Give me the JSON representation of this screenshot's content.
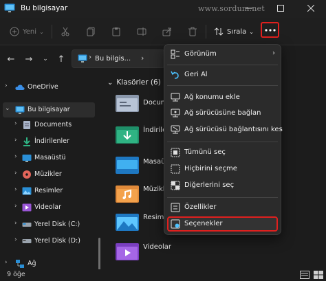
{
  "window": {
    "title": "Bu bilgisayar",
    "watermark": "www.sordum.net"
  },
  "toolbar": {
    "new_label": "Yeni",
    "sort_label": "Sırala"
  },
  "address": {
    "crumb": "Bu bilgis..."
  },
  "sidebar": {
    "items": [
      {
        "label": "OneDrive",
        "icon": "cloud-icon"
      },
      {
        "label": "Bu bilgisayar",
        "icon": "computer-icon"
      },
      {
        "label": "Documents",
        "icon": "documents-icon"
      },
      {
        "label": "İndirilenler",
        "icon": "downloads-icon"
      },
      {
        "label": "Masaüstü",
        "icon": "desktop-icon"
      },
      {
        "label": "Müzikler",
        "icon": "music-icon"
      },
      {
        "label": "Resimler",
        "icon": "pictures-icon"
      },
      {
        "label": "Videolar",
        "icon": "videos-icon"
      },
      {
        "label": "Yerel Disk (C:)",
        "icon": "drive-icon"
      },
      {
        "label": "Yerel Disk (D:)",
        "icon": "drive-icon"
      },
      {
        "label": "Ağ",
        "icon": "network-icon"
      }
    ]
  },
  "main": {
    "group_header": "Klasörler (6)",
    "folders": [
      {
        "label": "Docum",
        "icon": "documents-folder-icon"
      },
      {
        "label": "İndirile",
        "icon": "downloads-folder-icon"
      },
      {
        "label": "Masaüs",
        "icon": "desktop-folder-icon"
      },
      {
        "label": "Müzikle",
        "icon": "music-folder-icon"
      },
      {
        "label": "Resimle",
        "icon": "pictures-folder-icon"
      },
      {
        "label": "Videolar",
        "icon": "videos-folder-icon"
      }
    ]
  },
  "menu": {
    "items": [
      {
        "label": "Görünüm",
        "icon": "view-icon",
        "submenu": true
      },
      {
        "label": "Geri Al",
        "icon": "undo-icon"
      },
      {
        "label": "Ağ konumu ekle",
        "icon": "add-network-location-icon"
      },
      {
        "label": "Ağ sürücüsüne bağlan",
        "icon": "map-network-drive-icon"
      },
      {
        "label": "Ağ sürücüsü bağlantısını kes",
        "icon": "disconnect-network-drive-icon"
      },
      {
        "label": "Tümünü seç",
        "icon": "select-all-icon"
      },
      {
        "label": "Hiçbirini seçme",
        "icon": "select-none-icon"
      },
      {
        "label": "Diğerlerini seç",
        "icon": "invert-selection-icon"
      },
      {
        "label": "Özellikler",
        "icon": "properties-icon"
      },
      {
        "label": "Seçenekler",
        "icon": "options-icon",
        "highlighted": true
      }
    ]
  },
  "status": {
    "count": "9 öğe"
  },
  "colors": {
    "highlight_border": "#e0201e",
    "accent": "#4cc2ff",
    "folder_yellow": "#f0c24a"
  }
}
